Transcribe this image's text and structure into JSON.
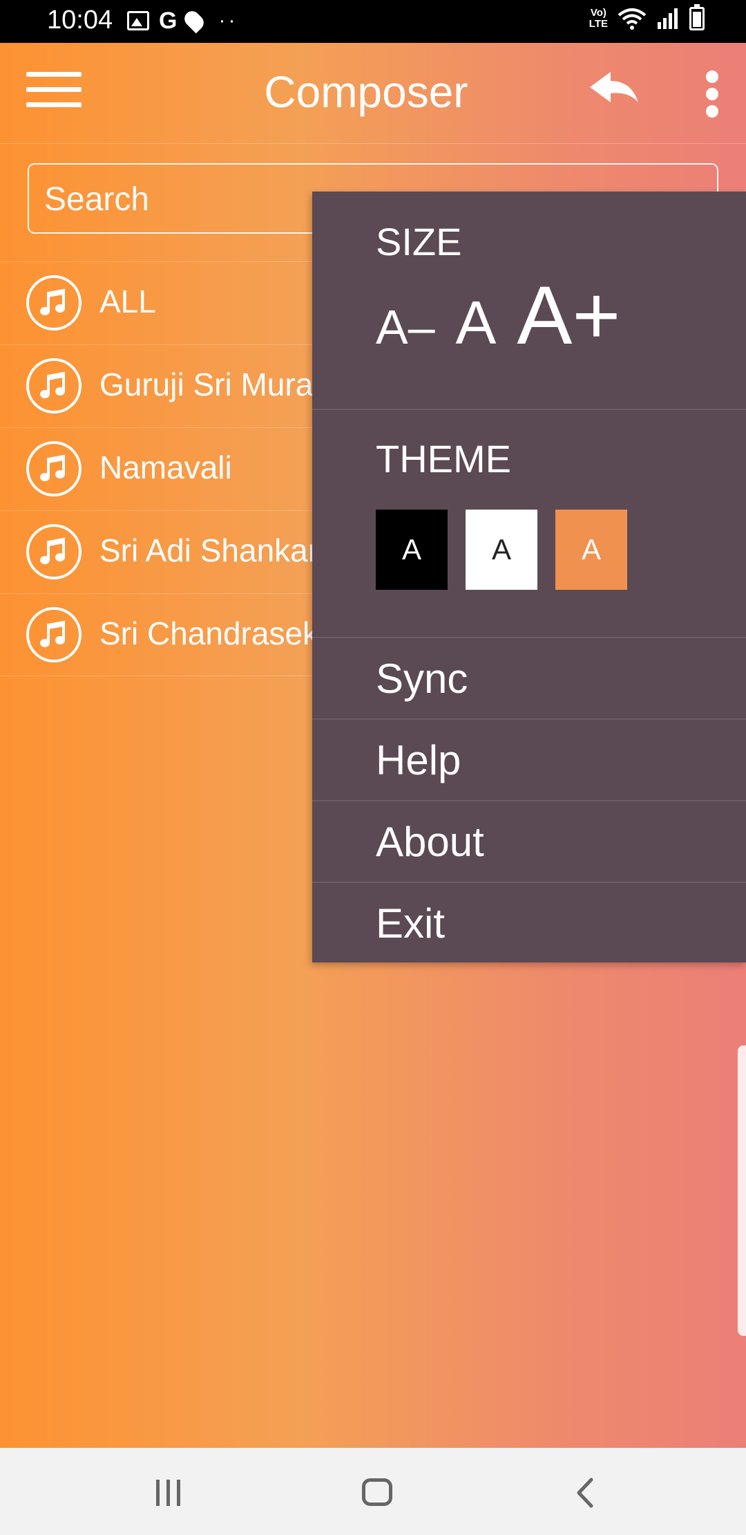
{
  "status_bar": {
    "time": "10:04",
    "left_icons": [
      "gallery-icon",
      "google-icon",
      "location-pin-icon",
      "more-notifications-icon"
    ],
    "g_glyph": "G",
    "dots": "··",
    "network_label_top": "Vo)",
    "network_label_bottom": "LTE",
    "right_icons": [
      "volte-icon",
      "wifi-icon",
      "signal-icon",
      "battery-charging-icon"
    ]
  },
  "app_bar": {
    "title": "Composer",
    "icons": [
      "menu-icon",
      "reply-back-icon",
      "more-vert-icon"
    ]
  },
  "search": {
    "placeholder": "Search",
    "value": ""
  },
  "composers": [
    {
      "label": "ALL"
    },
    {
      "label": "Guruji Sri Murali"
    },
    {
      "label": "Namavali"
    },
    {
      "label": "Sri Adi Shankara"
    },
    {
      "label": "Sri Chandrasekhara"
    }
  ],
  "overflow_menu": {
    "size_heading": "SIZE",
    "size_options": [
      "A–",
      "A",
      "A+"
    ],
    "theme_heading": "THEME",
    "theme_options": [
      {
        "label": "A",
        "color": "#000000"
      },
      {
        "label": "A",
        "color": "#ffffff"
      },
      {
        "label": "A",
        "color": "#f09150"
      }
    ],
    "items": [
      "Sync",
      "Help",
      "About",
      "Exit"
    ]
  },
  "colors": {
    "gradient_start": "#fd9232",
    "gradient_end": "#ec7f77",
    "menu_bg": "#5b4953"
  },
  "nav_bar": {
    "icons": [
      "recents-icon",
      "home-icon",
      "back-icon"
    ]
  }
}
